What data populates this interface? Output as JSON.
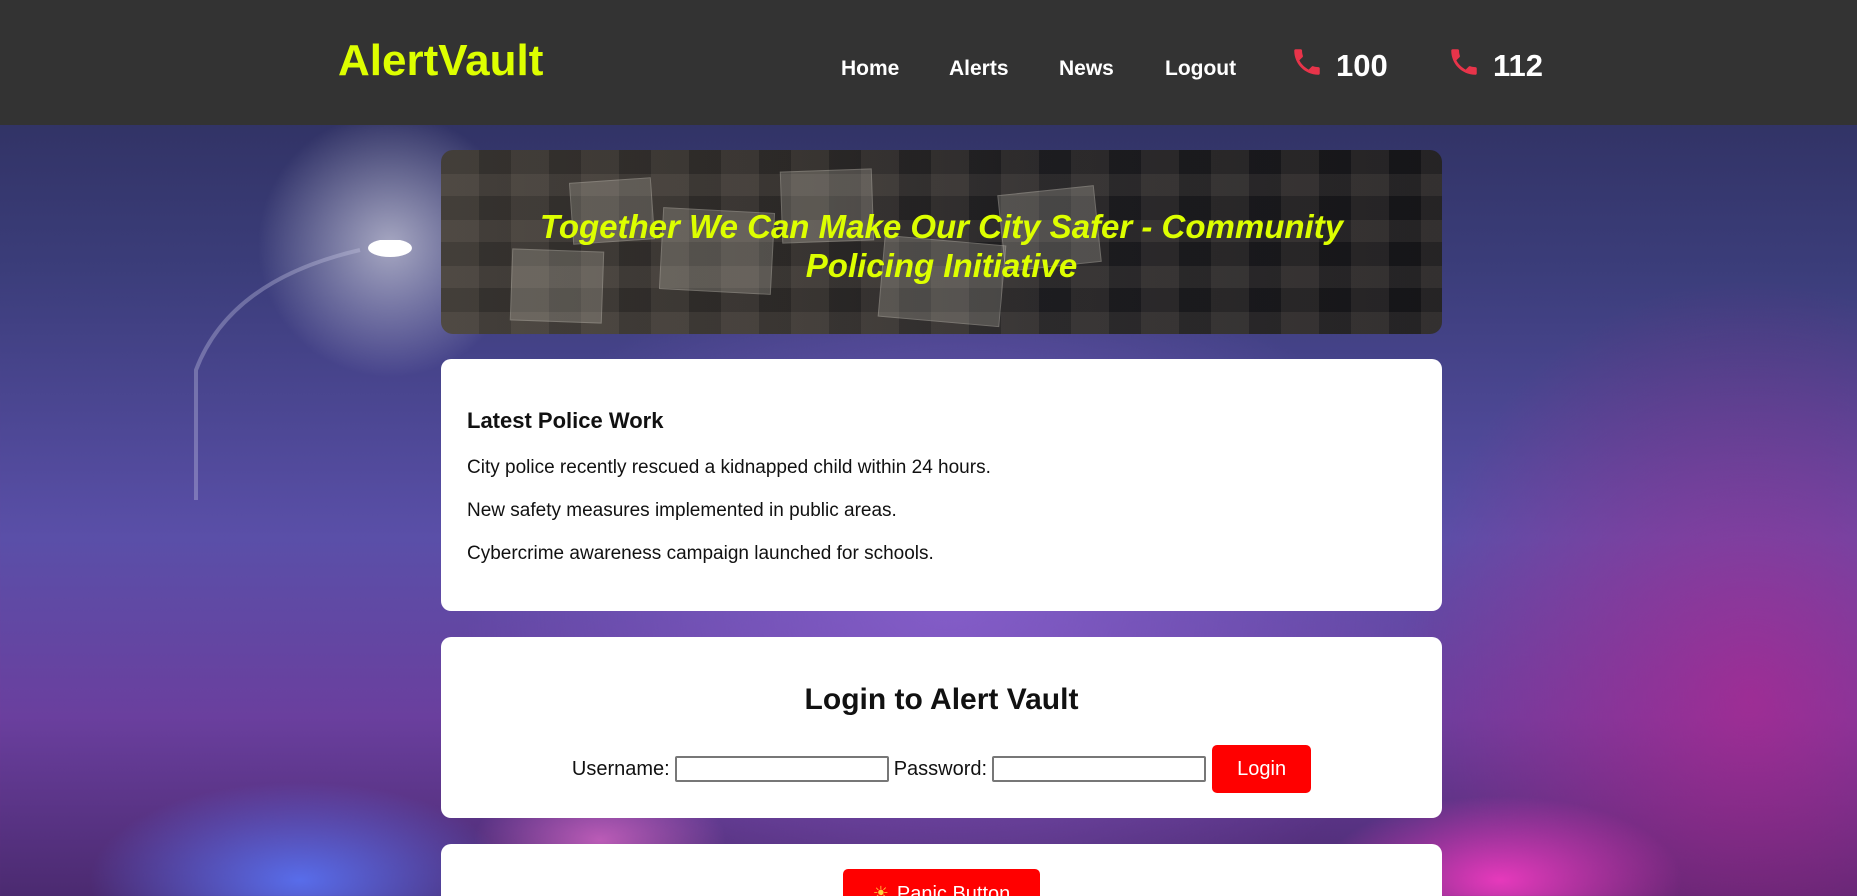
{
  "header": {
    "brand": "AlertVault",
    "nav": [
      "Home",
      "Alerts",
      "News",
      "Logout"
    ],
    "helplines": [
      {
        "icon": "phone-icon",
        "number": "100"
      },
      {
        "icon": "phone-icon",
        "number": "112"
      }
    ]
  },
  "banner": {
    "title": "Together We Can Make Our City Safer - Community Policing Initiative"
  },
  "news": {
    "title": "Latest Police Work",
    "items": [
      "City police recently rescued a kidnapped child within 24 hours.",
      "New safety measures implemented in public areas.",
      "Cybercrime awareness campaign launched for schools."
    ]
  },
  "login": {
    "title": "Login to Alert Vault",
    "username_label": "Username:",
    "password_label": "Password:",
    "username_value": "",
    "password_value": "",
    "button": "Login"
  },
  "panic": {
    "icon": "siren-icon",
    "button": "Panic Button"
  },
  "colors": {
    "header_bg": "#333333",
    "brand": "#ddff00",
    "accent_button": "#ff0000",
    "phone_icon": "#e8344a"
  }
}
